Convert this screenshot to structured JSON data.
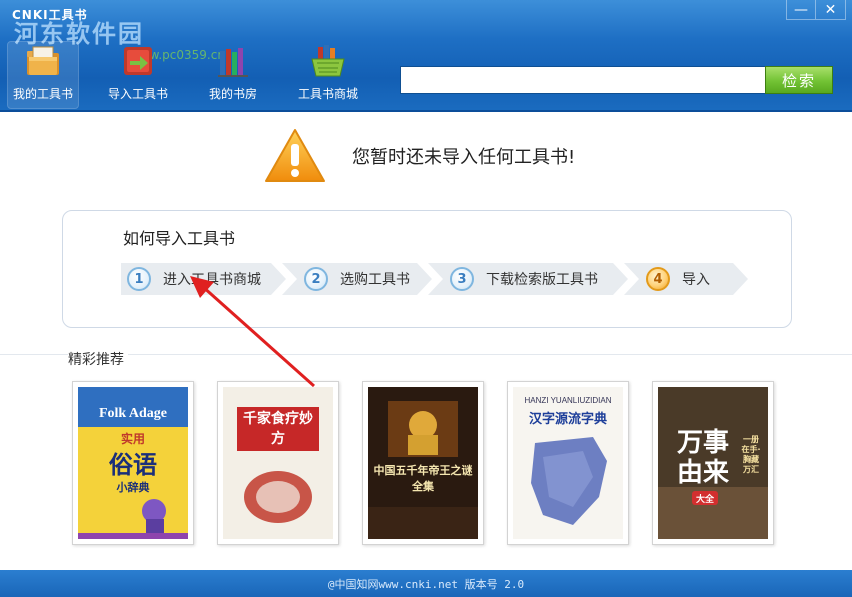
{
  "window": {
    "title": "CNKI工具书",
    "watermark": "河东软件园",
    "watermark_url": "www.pc0359.cn",
    "minimize_glyph": "—",
    "close_glyph": "✕"
  },
  "nav": [
    {
      "label": "我的工具书",
      "icon": "book-folder-icon",
      "active": true
    },
    {
      "label": "导入工具书",
      "icon": "import-books-icon",
      "active": false
    },
    {
      "label": "我的书房",
      "icon": "bookshelf-icon",
      "active": false
    },
    {
      "label": "工具书商城",
      "icon": "shopping-basket-icon",
      "active": false
    }
  ],
  "search": {
    "value": "",
    "placeholder": "",
    "button_label": "检索"
  },
  "notice": {
    "text": "您暂时还未导入任何工具书!",
    "icon": "warning-icon"
  },
  "howto": {
    "title": "如何导入工具书",
    "steps": [
      {
        "num": "1",
        "label": "进入工具书商城"
      },
      {
        "num": "2",
        "label": "选购工具书"
      },
      {
        "num": "3",
        "label": "下载检索版工具书"
      },
      {
        "num": "4",
        "label": "导入"
      }
    ]
  },
  "recommend": {
    "title": "精彩推荐",
    "books": [
      {
        "en": "Folk Adage",
        "title": "俗语",
        "top": "实用",
        "sub": "小辞典"
      },
      {
        "title": "千家食疗妙方"
      },
      {
        "title": "中国五千年帝王之谜全集"
      },
      {
        "en": "HANZI YUANLIUZIDIAN",
        "title": "汉字源流字典"
      },
      {
        "title": "万事由来",
        "sub": "大全",
        "side": "一册在手·胸藏万汇"
      }
    ]
  },
  "footer": {
    "text": "@中国知网www.cnki.net 版本号 2.0"
  },
  "colors": {
    "header": "#1e6fc4",
    "search_button": "#72c234",
    "warning": "#f6a31a",
    "arrow": "#e02020"
  }
}
